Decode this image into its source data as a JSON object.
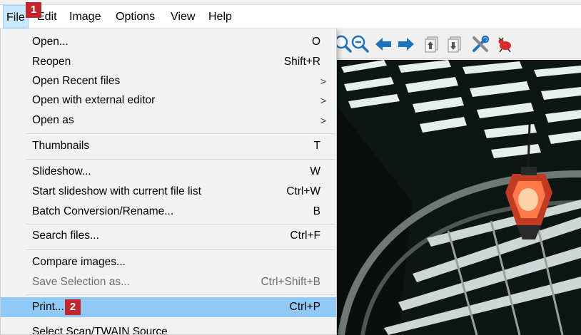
{
  "menubar": {
    "items": [
      "File",
      "Edit",
      "Image",
      "Options",
      "View",
      "Help"
    ],
    "badge": "1"
  },
  "file_menu": {
    "items": [
      {
        "label": "Open...",
        "shortcut": "O"
      },
      {
        "label": "Reopen",
        "shortcut": "Shift+R"
      },
      {
        "label": "Open Recent files",
        "submenu": ">"
      },
      {
        "label": "Open with external editor",
        "submenu": ">"
      },
      {
        "label": "Open as",
        "submenu": ">"
      },
      {
        "label": "Thumbnails",
        "shortcut": "T"
      },
      {
        "label": "Slideshow...",
        "shortcut": "W"
      },
      {
        "label": "Start slideshow with current file list",
        "shortcut": "Ctrl+W"
      },
      {
        "label": "Batch Conversion/Rename...",
        "shortcut": "B"
      },
      {
        "label": "Search files...",
        "shortcut": "Ctrl+F"
      },
      {
        "label": "Compare images..."
      },
      {
        "label": "Save Selection as...",
        "shortcut": "Ctrl+Shift+B"
      },
      {
        "label": "Print...",
        "shortcut": "Ctrl+P"
      },
      {
        "label": "Select Scan/TWAIN Source"
      }
    ],
    "print_badge": "2"
  },
  "toolbar": {
    "icons": [
      "zoom-in-icon",
      "zoom-out-icon",
      "arrow-left-icon",
      "arrow-right-icon",
      "first-page-icon",
      "last-page-icon",
      "tools-icon",
      "bug-icon"
    ]
  },
  "colors": {
    "badge": "#c0262e",
    "highlight": "#90c8f6",
    "menu_active": "#cce8ff",
    "nav_arrow": "#1e73be"
  }
}
